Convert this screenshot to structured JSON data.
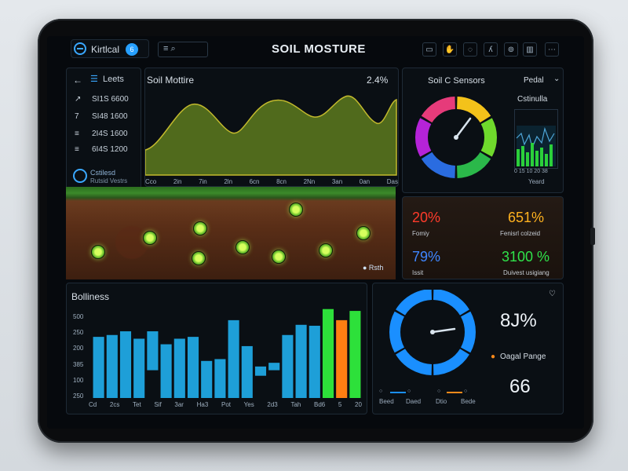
{
  "header": {
    "brand": "Kirtlcal",
    "badge": "6",
    "search_label": "≡ ⌕",
    "title": "SOIL MOSTURE"
  },
  "left_nav": {
    "back_glyph": "←",
    "title": "Leets",
    "items": [
      {
        "glyph": "↗",
        "text": "SI1S 6600"
      },
      {
        "glyph": "7",
        "text": "SI48 1600"
      },
      {
        "glyph": "≡",
        "text": "2I4S 1600"
      },
      {
        "glyph": "≡",
        "text": "6I4S 1200"
      }
    ],
    "footer_line1": "Cstilesd",
    "footer_line2": "Rutsid Vestrs"
  },
  "moisture_chart": {
    "title": "Soil Mottire",
    "value": "2.4%",
    "ticks": [
      "Cco",
      "2in",
      "7in",
      "2ln",
      "6cn",
      "8cn",
      "2Nn",
      "3an",
      "0an",
      "Das"
    ]
  },
  "soil_strip": {
    "caption": "● Rsth"
  },
  "sensors": {
    "title": "Soil C Sensors",
    "dropdown": "Pedal",
    "mini_title": "Cstinulla",
    "mini_ticks": "0 15 10 20 38",
    "mini_caption": "Yeard",
    "segments": [
      "#f3c21a",
      "#6fd92c",
      "#2bb84a",
      "#2a6ce0",
      "#b523d8",
      "#e63b7a"
    ]
  },
  "stats": [
    {
      "value": "20%",
      "label": "Fomiy",
      "color": "#ff3b2b"
    },
    {
      "value": "651%",
      "label": "Fenisrl colzeid",
      "color": "#ffb21f"
    },
    {
      "value": "79%",
      "label": "Issit",
      "color": "#3f86ff"
    },
    {
      "value": "3100 %",
      "label": "Duivest usigiang",
      "color": "#2fe34a"
    }
  ],
  "bar_panel": {
    "title": "Bolliness",
    "ticks_y": [
      "500",
      "250",
      "200",
      "385",
      "100",
      "250"
    ],
    "ticks_x": [
      "Cd",
      "2cs",
      "Tet",
      "Sif",
      "3ar",
      "Ha3",
      "Pot",
      "Yes",
      "2d3",
      "Tah",
      "Bd6",
      "5",
      "20"
    ]
  },
  "chart_data": {
    "type": "bar",
    "categories": [],
    "ylim": [
      0,
      500
    ],
    "colors": [
      "#1e9fd8",
      "#1e9fd8",
      "#1e9fd8",
      "#1e9fd8",
      "#1e9fd8",
      "#1e9fd8",
      "#1e9fd8",
      "#1e9fd8",
      "#1e9fd8",
      "#1e9fd8",
      "#1e9fd8",
      "#1e9fd8",
      "#1e9fd8",
      "#1e9fd8",
      "#1e9fd8",
      "#1e9fd8",
      "#1e9fd8",
      "#2de03a",
      "#ff7e12",
      "#2de03a"
    ],
    "values": [
      330,
      340,
      360,
      320,
      360,
      290,
      320,
      330,
      200,
      210,
      420,
      280,
      170,
      190,
      340,
      395,
      390,
      480,
      420,
      470
    ],
    "baselines": [
      0,
      0,
      0,
      0,
      150,
      0,
      0,
      0,
      0,
      0,
      0,
      0,
      120,
      150,
      0,
      0,
      0,
      0,
      0,
      0
    ]
  },
  "gauge_panel": {
    "value": "8J%",
    "legend": "Oagal Pange",
    "reading": "66",
    "legend_items": [
      "Beed",
      "Daed",
      "Dtio",
      "Bede"
    ],
    "colors": [
      "#1a8fff",
      "#1a8fff",
      "#ff8a1a",
      "#1a8fff"
    ]
  }
}
